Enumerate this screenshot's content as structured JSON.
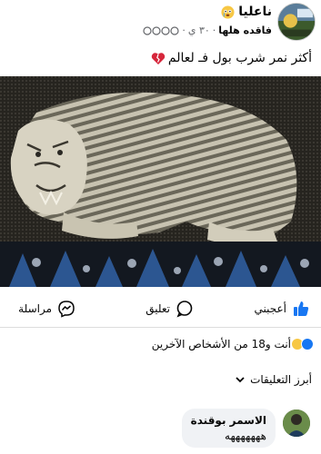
{
  "post": {
    "page_name": "ناعليا",
    "author": "فاقده هلها",
    "time": "٣٠ ي",
    "caption": "أكثر نمر شرب بول فـ لعالم"
  },
  "actions": {
    "like_label": "أعجبني",
    "comment_label": "تعليق",
    "message_label": "مراسلة"
  },
  "reactions": {
    "summary": "أنت و18 من الأشخاص الآخرين"
  },
  "comments_section": {
    "heading": "أبرز التعليقات"
  },
  "comment": {
    "author": "الاسمر بوقندة",
    "text": "هههههههه"
  },
  "icons": {
    "like": "thumbs-up-icon",
    "comment": "comment-bubble-icon",
    "message": "messenger-icon",
    "heart": "broken-heart-icon",
    "chevron": "chevron-down-icon"
  },
  "colors": {
    "facebook_blue": "#1877f2",
    "secondary_text": "#65676b",
    "comment_bg": "#f0f2f5"
  }
}
